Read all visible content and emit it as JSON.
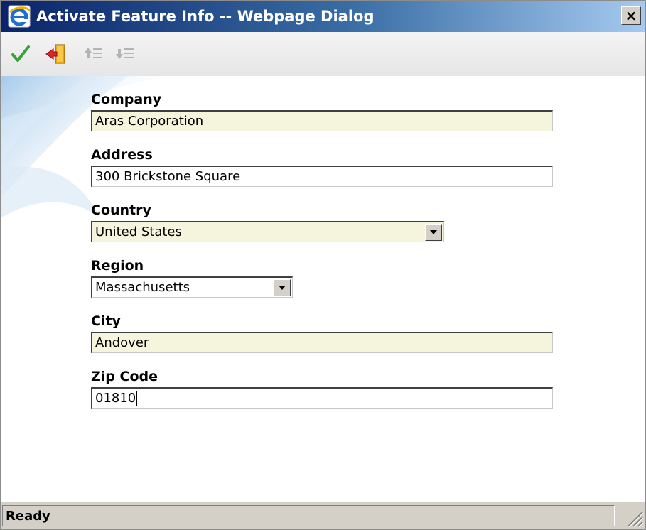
{
  "window": {
    "title": "Activate Feature Info -- Webpage Dialog",
    "close_label": "×"
  },
  "toolbar": {
    "buttons": [
      {
        "icon": "checkmark-icon",
        "enabled": true
      },
      {
        "icon": "exit-door-icon",
        "enabled": true
      },
      {
        "icon": "move-up-icon",
        "enabled": false
      },
      {
        "icon": "move-down-icon",
        "enabled": false
      }
    ]
  },
  "form": {
    "company": {
      "label": "Company",
      "value": "Aras Corporation"
    },
    "address": {
      "label": "Address",
      "value": "300 Brickstone Square"
    },
    "country": {
      "label": "Country",
      "value": "United States"
    },
    "region": {
      "label": "Region",
      "value": "Massachusetts"
    },
    "city": {
      "label": "City",
      "value": "Andover"
    },
    "zip": {
      "label": "Zip Code",
      "value": "01810"
    }
  },
  "status": {
    "text": "Ready"
  },
  "colors": {
    "readonly_field": "#f5f4dc",
    "title_gradient_start": "#0a246a",
    "title_gradient_end": "#a6caf0"
  }
}
